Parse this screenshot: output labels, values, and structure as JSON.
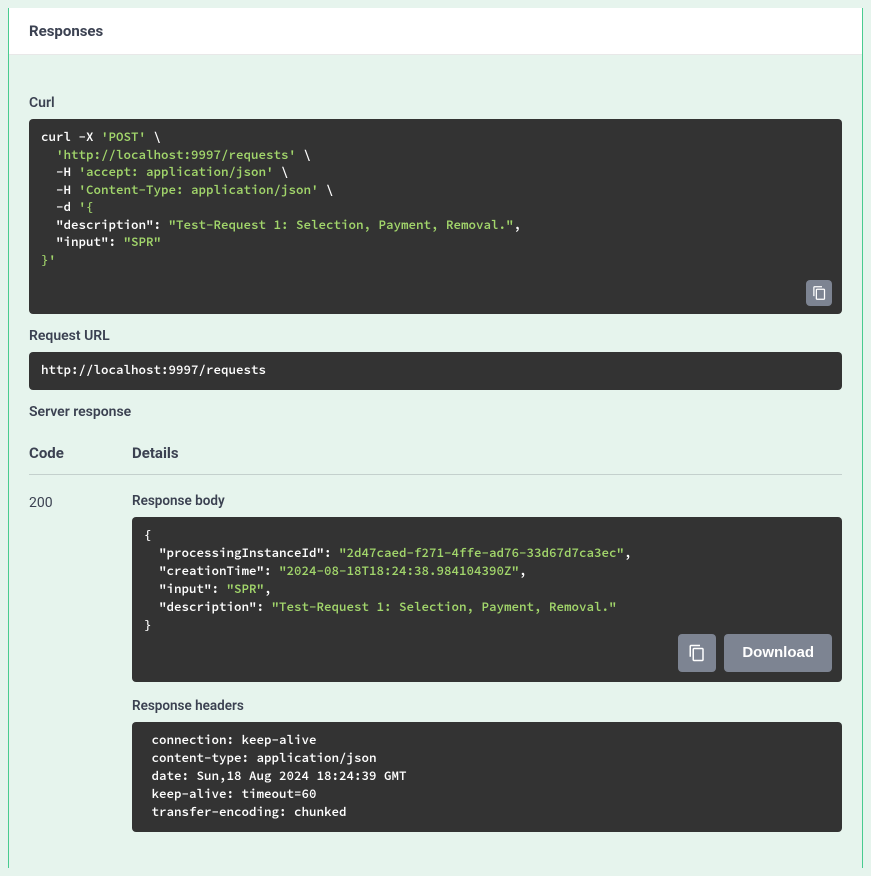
{
  "responses_title": "Responses",
  "curl": {
    "label": "Curl",
    "command_parts": {
      "p1": "curl -X ",
      "method": "'POST'",
      "p2": " \\\n  ",
      "url": "'http://localhost:9997/requests'",
      "p3": " \\\n  -H ",
      "h1": "'accept: application/json'",
      "p4": " \\\n  -H ",
      "h2": "'Content-Type: application/json'",
      "p5": " \\\n  -d ",
      "body_open": "'{",
      "p6": "\n  ",
      "k1": "\"description\"",
      "p7": ": ",
      "v1": "\"Test-Request 1: Selection, Payment, Removal.\"",
      "p8": ",\n  ",
      "k2": "\"input\"",
      "p9": ": ",
      "v2": "\"SPR\"",
      "p10": "\n",
      "body_close": "}'"
    }
  },
  "request_url": {
    "label": "Request URL",
    "value": "http://localhost:9997/requests"
  },
  "server_response": {
    "label": "Server response",
    "code_header": "Code",
    "details_header": "Details",
    "status_code": "200",
    "body_label": "Response body",
    "body_parts": {
      "open": "{",
      "p1": "\n  ",
      "k1": "\"processingInstanceId\"",
      "c1": ": ",
      "v1": "\"2d47caed-f271-4ffe-ad76-33d67d7ca3ec\"",
      "comma1": ",",
      "p2": "\n  ",
      "k2": "\"creationTime\"",
      "c2": ": ",
      "v2": "\"2024-08-18T18:24:38.984104390Z\"",
      "comma2": ",",
      "p3": "\n  ",
      "k3": "\"input\"",
      "c3": ": ",
      "v3": "\"SPR\"",
      "comma3": ",",
      "p4": "\n  ",
      "k4": "\"description\"",
      "c4": ": ",
      "v4": "\"Test-Request 1: Selection, Payment, Removal.\"",
      "p5": "\n",
      "close": "}"
    },
    "download_label": "Download",
    "headers_label": "Response headers",
    "headers_text": " connection: keep-alive \n content-type: application/json \n date: Sun,18 Aug 2024 18:24:39 GMT \n keep-alive: timeout=60 \n transfer-encoding: chunked "
  }
}
